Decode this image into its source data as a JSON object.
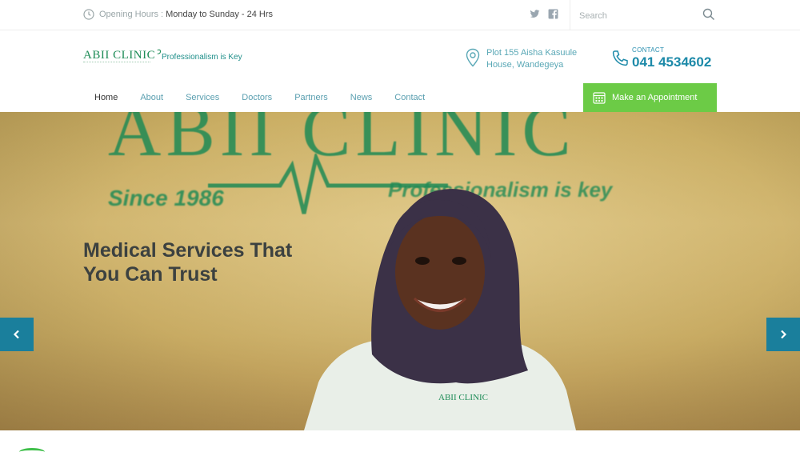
{
  "topbar": {
    "hours_label": "Opening Hours :",
    "hours_value": "Monday to Sunday - 24 Hrs",
    "search_placeholder": "Search"
  },
  "header": {
    "logo_text": "ABII CLINIC",
    "tagline": "Professionalism is Key",
    "address": "Plot 155 Aisha Kasuule House, Wandegeya",
    "contact_label": "CONTACT",
    "contact_number": "041 4534602"
  },
  "nav": {
    "items": [
      {
        "label": "Home"
      },
      {
        "label": "About"
      },
      {
        "label": "Services"
      },
      {
        "label": "Doctors"
      },
      {
        "label": "Partners"
      },
      {
        "label": "News"
      },
      {
        "label": "Contact"
      }
    ],
    "appointment_label": "Make an Appointment"
  },
  "hero": {
    "title": "Medical Services That You Can Trust",
    "wall_logo": "ABII CLINIC",
    "wall_since": "Since 1986",
    "wall_tagline": "Professionalism is key"
  },
  "colors": {
    "brand_green": "#1e8c57",
    "button_green": "#6ccb46",
    "accent_blue": "#1a7f9c"
  },
  "icons": {
    "clock": "clock-icon",
    "twitter": "twitter-icon",
    "facebook": "facebook-icon",
    "search": "search-icon",
    "pin": "location-pin-icon",
    "phone": "phone-icon",
    "calendar": "calendar-icon",
    "prev": "chevron-left-icon",
    "next": "chevron-right-icon"
  }
}
